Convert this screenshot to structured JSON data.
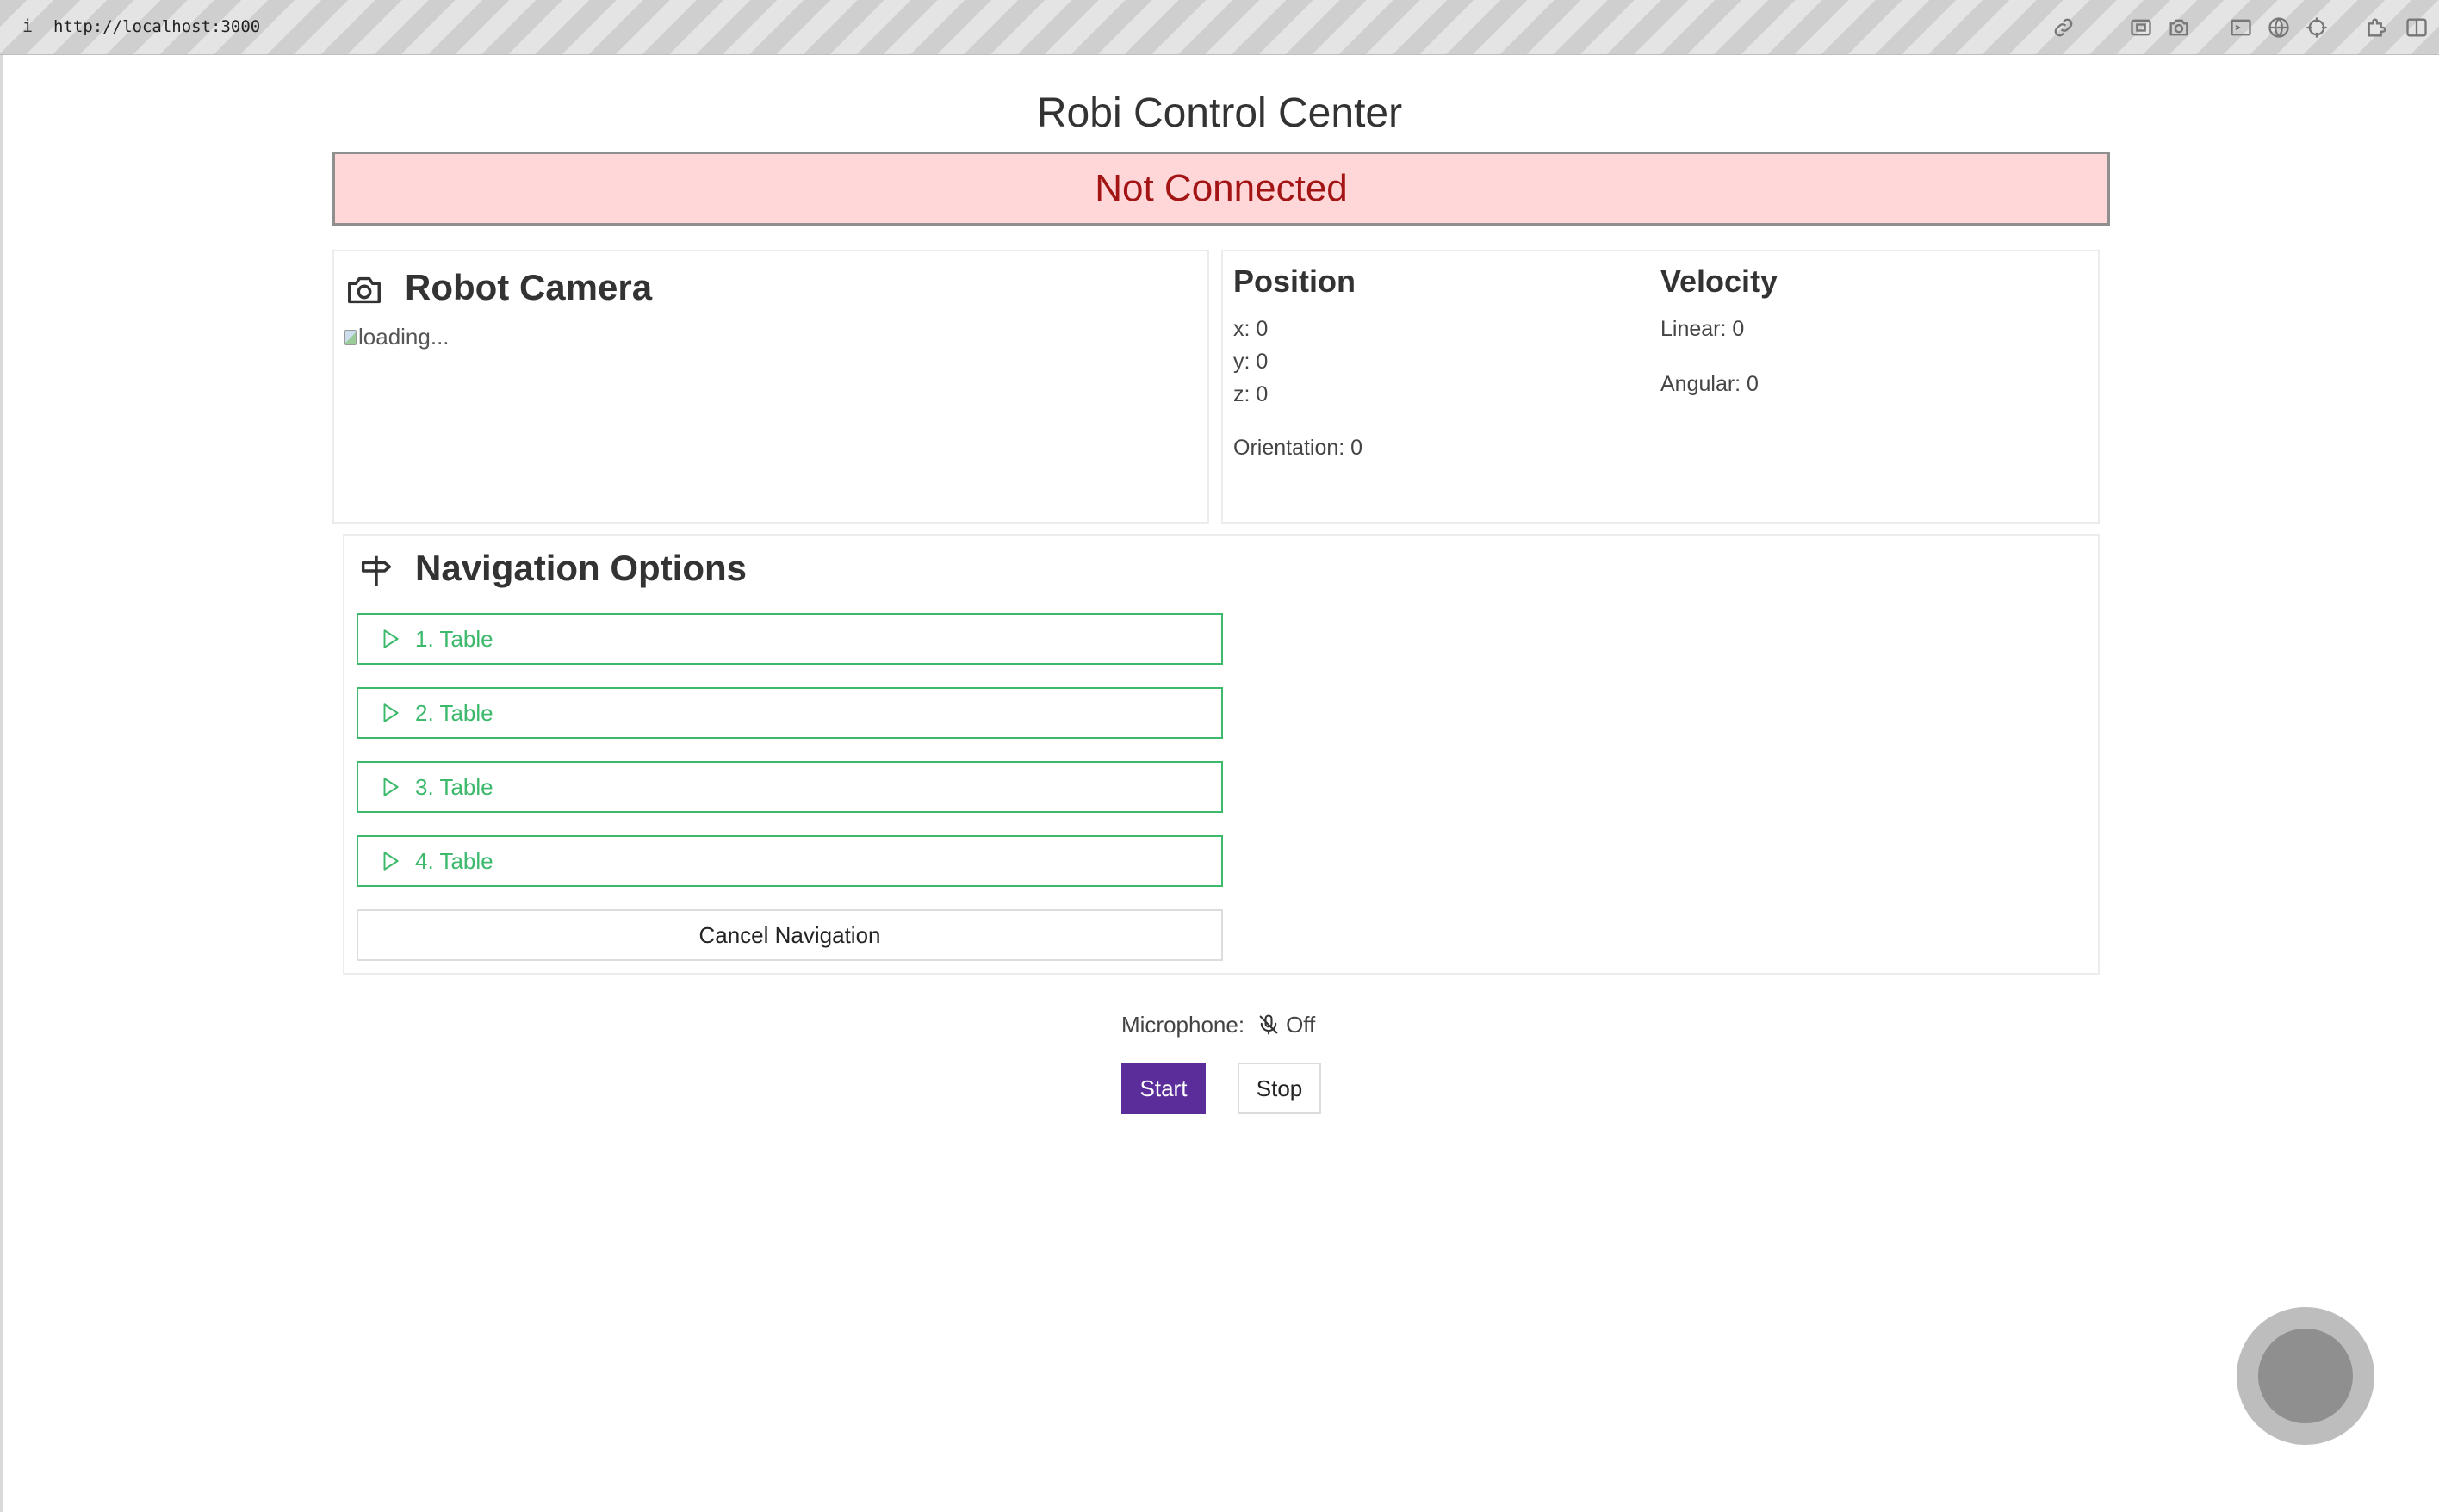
{
  "browser": {
    "info_icon": "i",
    "url": "http://localhost:3000",
    "icons": [
      "link-icon",
      "screenshot-icon",
      "camera-icon",
      "terminal-icon",
      "globe-icon",
      "crosshair-icon",
      "extensions-icon",
      "sidebar-icon"
    ]
  },
  "app": {
    "title": "Robi Control Center",
    "connection_status": "Not Connected"
  },
  "camera": {
    "title": "Robot Camera",
    "icon": "camera-icon",
    "image_alt": "loading..."
  },
  "position": {
    "title": "Position",
    "x": "x: 0",
    "y": "y: 0",
    "z": "z: 0",
    "orientation": "Orientation: 0"
  },
  "velocity": {
    "title": "Velocity",
    "linear": "Linear: 0",
    "angular": "Angular: 0"
  },
  "navigation": {
    "title": "Navigation Options",
    "icon": "signpost-icon",
    "options": [
      {
        "label": "1. Table"
      },
      {
        "label": "2. Table"
      },
      {
        "label": "3. Table"
      },
      {
        "label": "4. Table"
      }
    ],
    "cancel_label": "Cancel Navigation"
  },
  "microphone": {
    "label": "Microphone:",
    "icon": "mic-off-icon",
    "status": "Off",
    "start_label": "Start",
    "stop_label": "Stop"
  },
  "colors": {
    "banner_bg": "#ffd7d9",
    "banner_text": "#a31515",
    "nav_accent": "#3cb96b",
    "start_button": "#5b2d9b"
  }
}
